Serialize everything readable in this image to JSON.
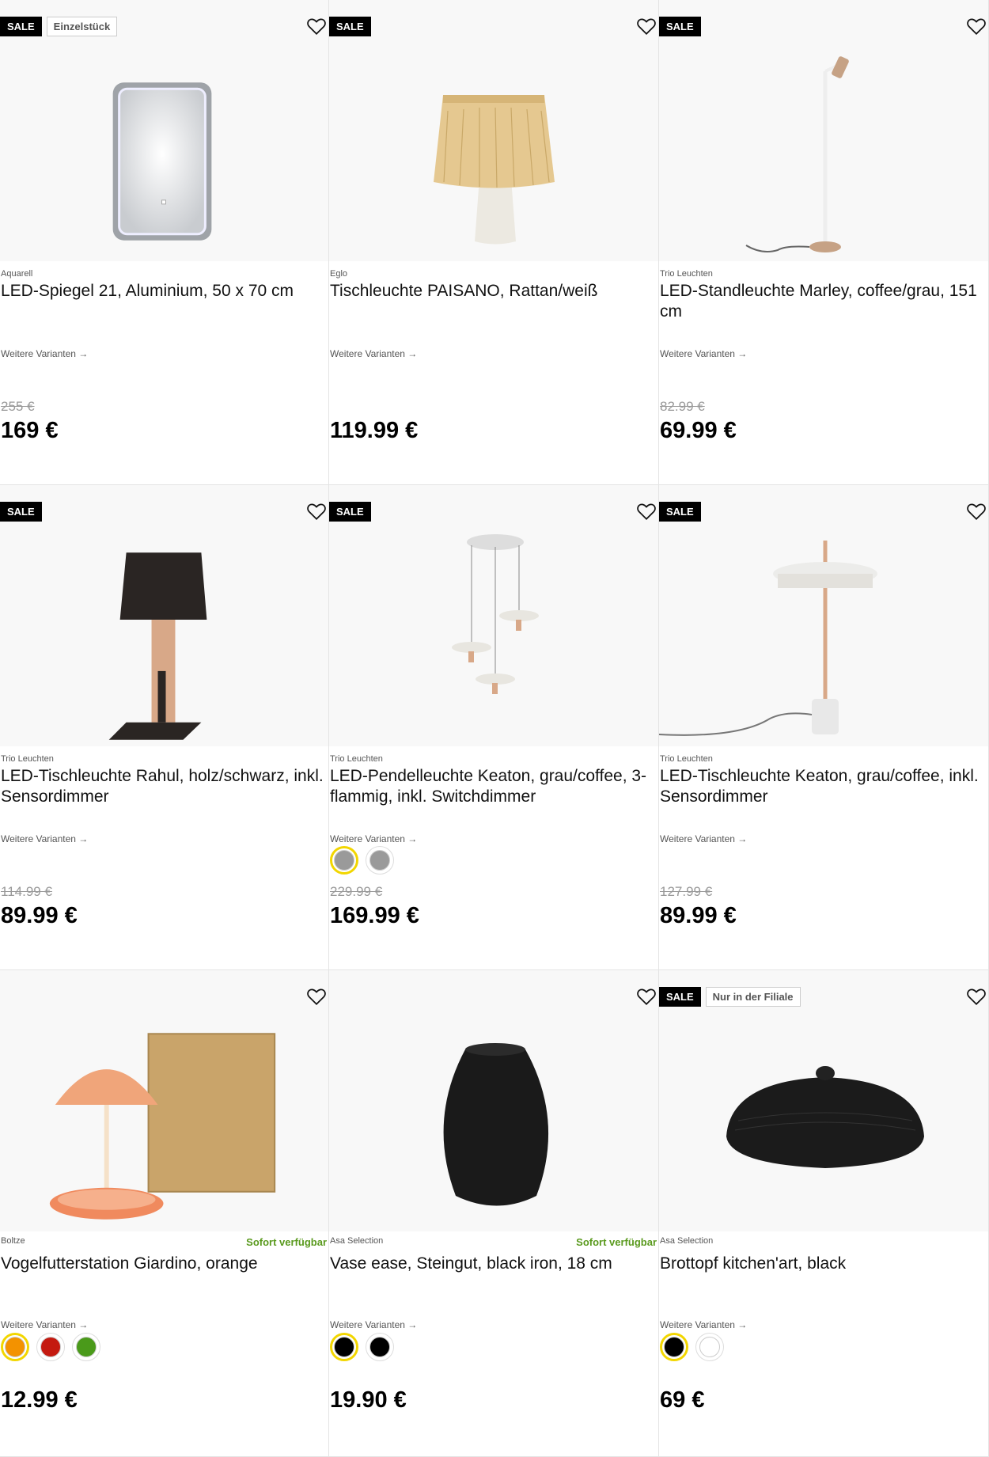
{
  "products": [
    {
      "badges": [
        "SALE",
        "Einzelstück"
      ],
      "brand": "Aquarell",
      "title": "LED-Spiegel 21, Aluminium, 50 x 70 cm",
      "variants_label": "Weitere Varianten →",
      "old_price": "255 €",
      "price": "169 €",
      "availability": "",
      "swatches": []
    },
    {
      "badges": [
        "SALE"
      ],
      "brand": "Eglo",
      "title": "Tischleuchte PAISANO, Rattan/weiß",
      "variants_label": "Weitere Varianten →",
      "old_price": "",
      "price": "119.99 €",
      "availability": "",
      "swatches": []
    },
    {
      "badges": [
        "SALE"
      ],
      "brand": "Trio Leuchten",
      "title": "LED-Standleuchte Marley, coffee/grau, 151 cm",
      "variants_label": "Weitere Varianten →",
      "old_price": "82.99 €",
      "price": "69.99 €",
      "availability": "",
      "swatches": []
    },
    {
      "badges": [
        "SALE"
      ],
      "brand": "Trio Leuchten",
      "title": "LED-Tischleuchte Rahul, holz/schwarz, inkl. Sensordimmer",
      "variants_label": "Weitere Varianten →",
      "old_price": "114.99 €",
      "price": "89.99 €",
      "availability": "",
      "swatches": []
    },
    {
      "badges": [
        "SALE"
      ],
      "brand": "Trio Leuchten",
      "title": "LED-Pendelleuchte Keaton, grau/coffee, 3-flammig, inkl. Switchdimmer",
      "variants_label": "Weitere Varianten →",
      "old_price": "229.99 €",
      "price": "169.99 €",
      "availability": "",
      "swatches": [
        "#9a9a9a",
        "#9a9a9a"
      ]
    },
    {
      "badges": [
        "SALE"
      ],
      "brand": "Trio Leuchten",
      "title": "LED-Tischleuchte Keaton, grau/coffee, inkl. Sensordimmer",
      "variants_label": "Weitere Varianten →",
      "old_price": "127.99 €",
      "price": "89.99 €",
      "availability": "",
      "swatches": []
    },
    {
      "badges": [],
      "brand": "Boltze",
      "title": "Vogelfutterstation Giardino, orange",
      "variants_label": "Weitere Varianten →",
      "old_price": "",
      "price": "12.99 €",
      "availability": "Sofort verfügbar",
      "swatches": [
        "#f39200",
        "#c41a10",
        "#4a9a1a"
      ]
    },
    {
      "badges": [],
      "brand": "Asa Selection",
      "title": "Vase ease, Steingut, black iron, 18 cm",
      "variants_label": "Weitere Varianten →",
      "old_price": "",
      "price": "19.90 €",
      "availability": "Sofort verfügbar",
      "swatches": [
        "#000000",
        "#000000"
      ]
    },
    {
      "badges": [
        "SALE",
        "Nur in der Filiale"
      ],
      "brand": "Asa Selection",
      "title": "Brottopf kitchen'art, black",
      "variants_label": "Weitere Varianten →",
      "old_price": "",
      "price": "69 €",
      "availability": "",
      "swatches": [
        "#000000",
        "#ffffff"
      ]
    }
  ],
  "icons": {
    "wishlist": "heart-outline-icon"
  },
  "colors": {
    "sale_badge_bg": "#000000",
    "availability": "#5a9a1e",
    "selected_swatch_ring": "#f2d600"
  }
}
